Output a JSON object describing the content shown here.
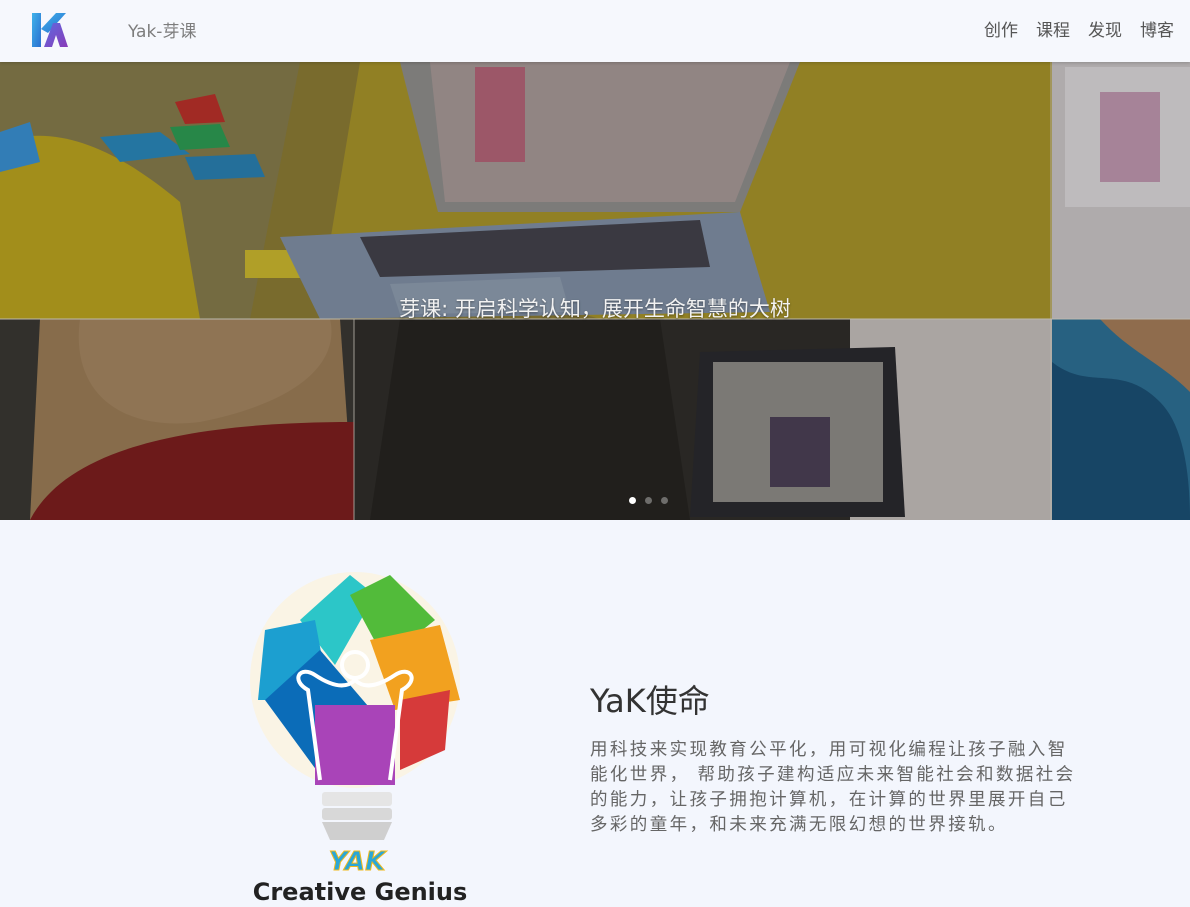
{
  "nav": {
    "brand": "Yak-芽课",
    "items": [
      "创作",
      "课程",
      "发现",
      "博客"
    ]
  },
  "hero": {
    "caption": "芽课: 开启科学认知，展开生命智慧的大树",
    "slide_count": 3,
    "active_slide": 1
  },
  "mission": {
    "title": "YaK使命",
    "text": "用科技来实现教育公平化，用可视化编程让孩子融入智能化世界， 帮助孩子建构适应未来智能社会和数据社会的能力，让孩子拥抱计算机，在计算的世界里展开自己多彩的童年，和未来充满无限幻想的世界接轨。",
    "logo_word": "YAK",
    "logo_tagline": "Creative Genius"
  },
  "colors": {
    "page_bg": "#f3f6fd",
    "nav_bg": "#f6f8fd",
    "mission_title": "#333333",
    "mission_text": "#666666"
  },
  "icons": {
    "logo": "yak-logo-icon",
    "bulb": "lightbulb-logo-icon"
  }
}
